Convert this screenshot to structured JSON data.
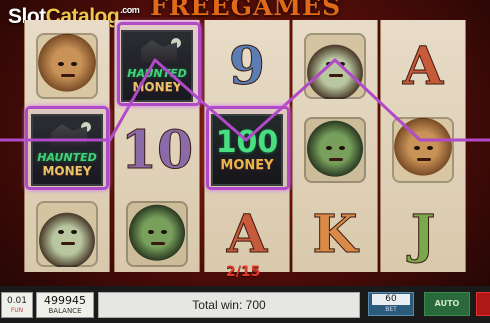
{
  "logo": {
    "part1": "Slot",
    "part2": "Catalog",
    "suffix": ".com"
  },
  "game": {
    "title": "FREEGAMES"
  },
  "reels": [
    {
      "symbols": [
        "wolf",
        "haunted-money",
        "witch"
      ]
    },
    {
      "symbols": [
        "haunted-money",
        "10",
        "frankenstein"
      ]
    },
    {
      "symbols": [
        "9",
        "money-100",
        "A"
      ]
    },
    {
      "symbols": [
        "witch",
        "frankenstein",
        "K"
      ]
    },
    {
      "symbols": [
        "A",
        "wolf",
        "J"
      ]
    }
  ],
  "symbol_text": {
    "haunted_money_top": "HAUNTED",
    "haunted_money_bottom": "MONEY",
    "money_value": "100",
    "money_label": "MONEY",
    "nine": "9",
    "ten": "10",
    "ace": "A",
    "king": "K",
    "jack": "J"
  },
  "colors": {
    "payline": "#b04ac8",
    "counter": "#e03a2a",
    "title": "#e06a18"
  },
  "free_spins": {
    "counter": "2/15"
  },
  "bottom_bar": {
    "coin_value": "0.01",
    "coin_label": "FUN",
    "balance_value": "499945",
    "balance_label": "BALANCE",
    "total_win_label": "Total win: 700",
    "bet_value": "60",
    "bet_label": "BET",
    "auto_label": "AUTO"
  }
}
